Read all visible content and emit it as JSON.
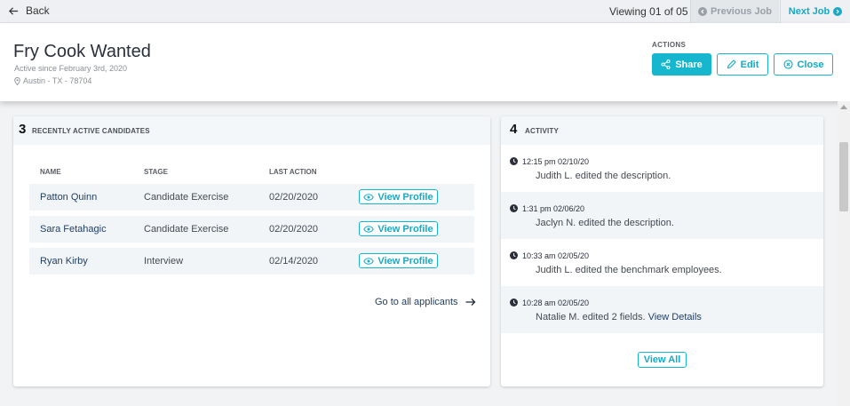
{
  "topbar": {
    "back_label": "Back",
    "viewing_text": "Viewing 01 of 05",
    "prev_job_label": "Previous Job",
    "next_job_label": "Next Job"
  },
  "job": {
    "title": "Fry Cook Wanted",
    "active_since": "Active since February 3rd, 2020",
    "location": "Austin - TX - 78704"
  },
  "actions": {
    "label": "ACTIONS",
    "share_label": "Share",
    "edit_label": "Edit",
    "close_label": "Close"
  },
  "candidates": {
    "number": "3",
    "title": "RECENTLY ACTIVE CANDIDATES",
    "columns": [
      "NAME",
      "STAGE",
      "LAST ACTION"
    ],
    "rows": [
      {
        "name": "Patton Quinn",
        "stage": "Candidate Exercise",
        "last_action": "02/20/2020",
        "action_label": "View Profile"
      },
      {
        "name": "Sara Fetahagic",
        "stage": "Candidate Exercise",
        "last_action": "02/20/2020",
        "action_label": "View Profile"
      },
      {
        "name": "Ryan Kirby",
        "stage": "Interview",
        "last_action": "02/14/2020",
        "action_label": "View Profile"
      }
    ],
    "all_applicants_label": "Go to all applicants"
  },
  "activity": {
    "number": "4",
    "title": "ACTIVITY",
    "items": [
      {
        "time": "12:15 pm 02/10/20",
        "description": "Judith L. edited the description.",
        "link": ""
      },
      {
        "time": "1:31 pm 02/06/20",
        "description": "Jaclyn N. edited the description.",
        "link": ""
      },
      {
        "time": "10:33 am 02/05/20",
        "description": "Judith L. edited the benchmark employees.",
        "link": ""
      },
      {
        "time": "10:28 am 02/05/20",
        "description": "Natalie M. edited 2 fields.",
        "link": "View Details"
      }
    ],
    "view_all_label": "View All"
  },
  "colors": {
    "accent": "#17b6cf",
    "link": "#1f3f66",
    "row_bg": "#f2f5f8"
  }
}
